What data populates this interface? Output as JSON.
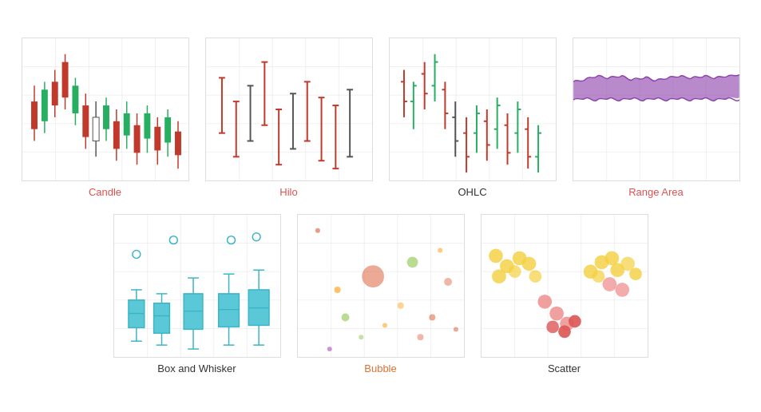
{
  "charts": {
    "row1": [
      {
        "id": "candle",
        "label": "Candle",
        "labelColor": "label-red"
      },
      {
        "id": "hilo",
        "label": "Hilo",
        "labelColor": "label-red"
      },
      {
        "id": "ohlc",
        "label": "OHLC",
        "labelColor": "label-black"
      },
      {
        "id": "range-area",
        "label": "Range Area",
        "labelColor": "label-red"
      }
    ],
    "row2": [
      {
        "id": "box-whisker",
        "label": "Box and Whisker",
        "labelColor": "label-black"
      },
      {
        "id": "bubble",
        "label": "Bubble",
        "labelColor": "label-orange"
      },
      {
        "id": "scatter",
        "label": "Scatter",
        "labelColor": "label-black"
      }
    ]
  }
}
